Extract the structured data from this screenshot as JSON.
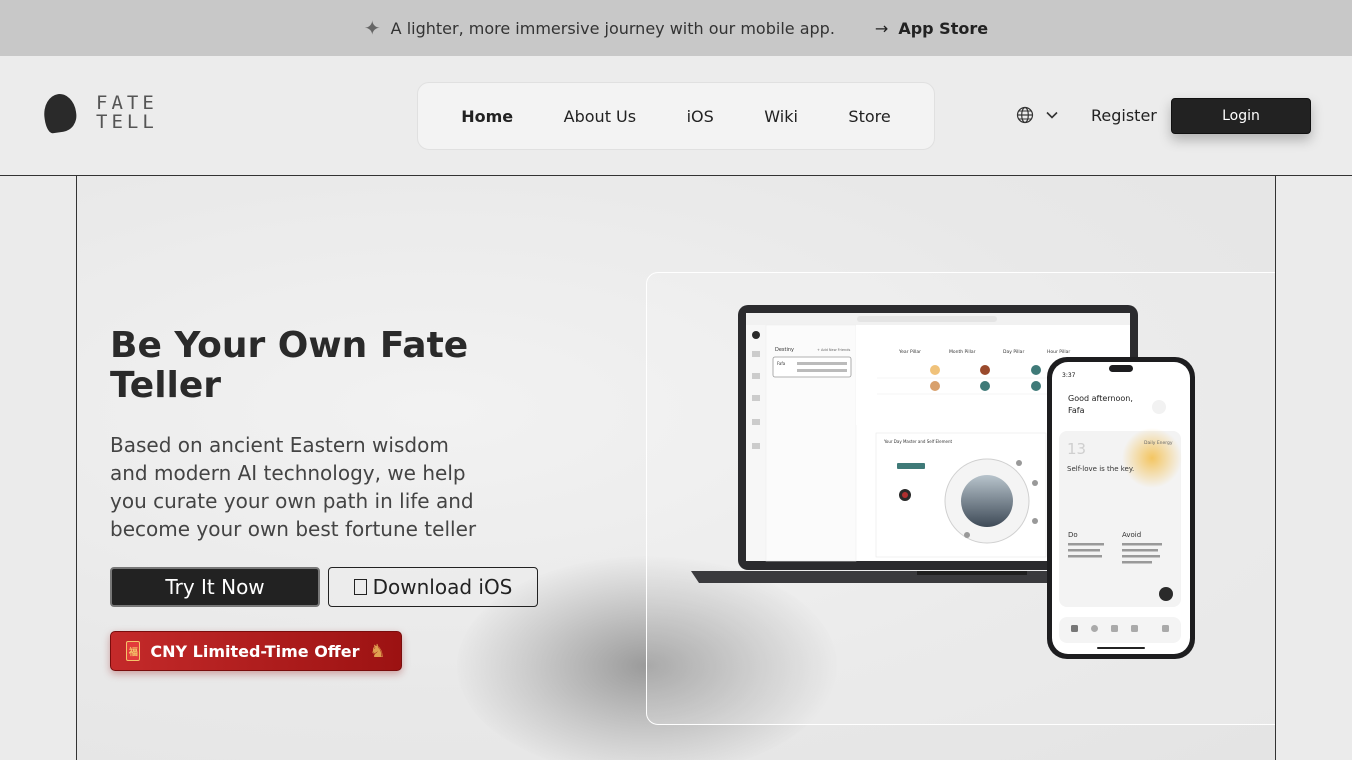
{
  "announcement": {
    "text": "A lighter, more immersive journey with our mobile app.",
    "cta": "App Store"
  },
  "header": {
    "logo_line1": "FATE",
    "logo_line2": "TELL",
    "nav": [
      {
        "label": "Home",
        "active": true
      },
      {
        "label": "About Us",
        "active": false
      },
      {
        "label": "iOS",
        "active": false
      },
      {
        "label": "Wiki",
        "active": false
      },
      {
        "label": "Store",
        "active": false
      }
    ],
    "register": "Register",
    "login": "Login"
  },
  "hero": {
    "title": "Be Your Own Fate Teller",
    "description": "Based on ancient Eastern wisdom and modern AI technology, we help you curate your own path in life and become your own best fortune teller",
    "try_button": "Try It Now",
    "download_button": "Download iOS",
    "offer_button": "CNY Limited-Time Offer"
  },
  "laptop_screen": {
    "sidebar_title": "Destiny",
    "add_button": "+ Add New Friends",
    "profile_name": "Fafa",
    "pillars": [
      "Year Pillar",
      "Month Pillar",
      "Day Pillar",
      "Hour Pillar"
    ],
    "section_title": "Your Day Master and Self Element"
  },
  "phone_screen": {
    "time": "3:37",
    "greeting": "Good afternoon,",
    "name": "Fafa",
    "day": "13",
    "energy_label": "Daily Energy",
    "quote": "Self-love is the key.",
    "do_label": "Do",
    "avoid_label": "Avoid"
  },
  "colors": {
    "accent_dark": "#222222",
    "offer_red": "#b01c1c"
  }
}
